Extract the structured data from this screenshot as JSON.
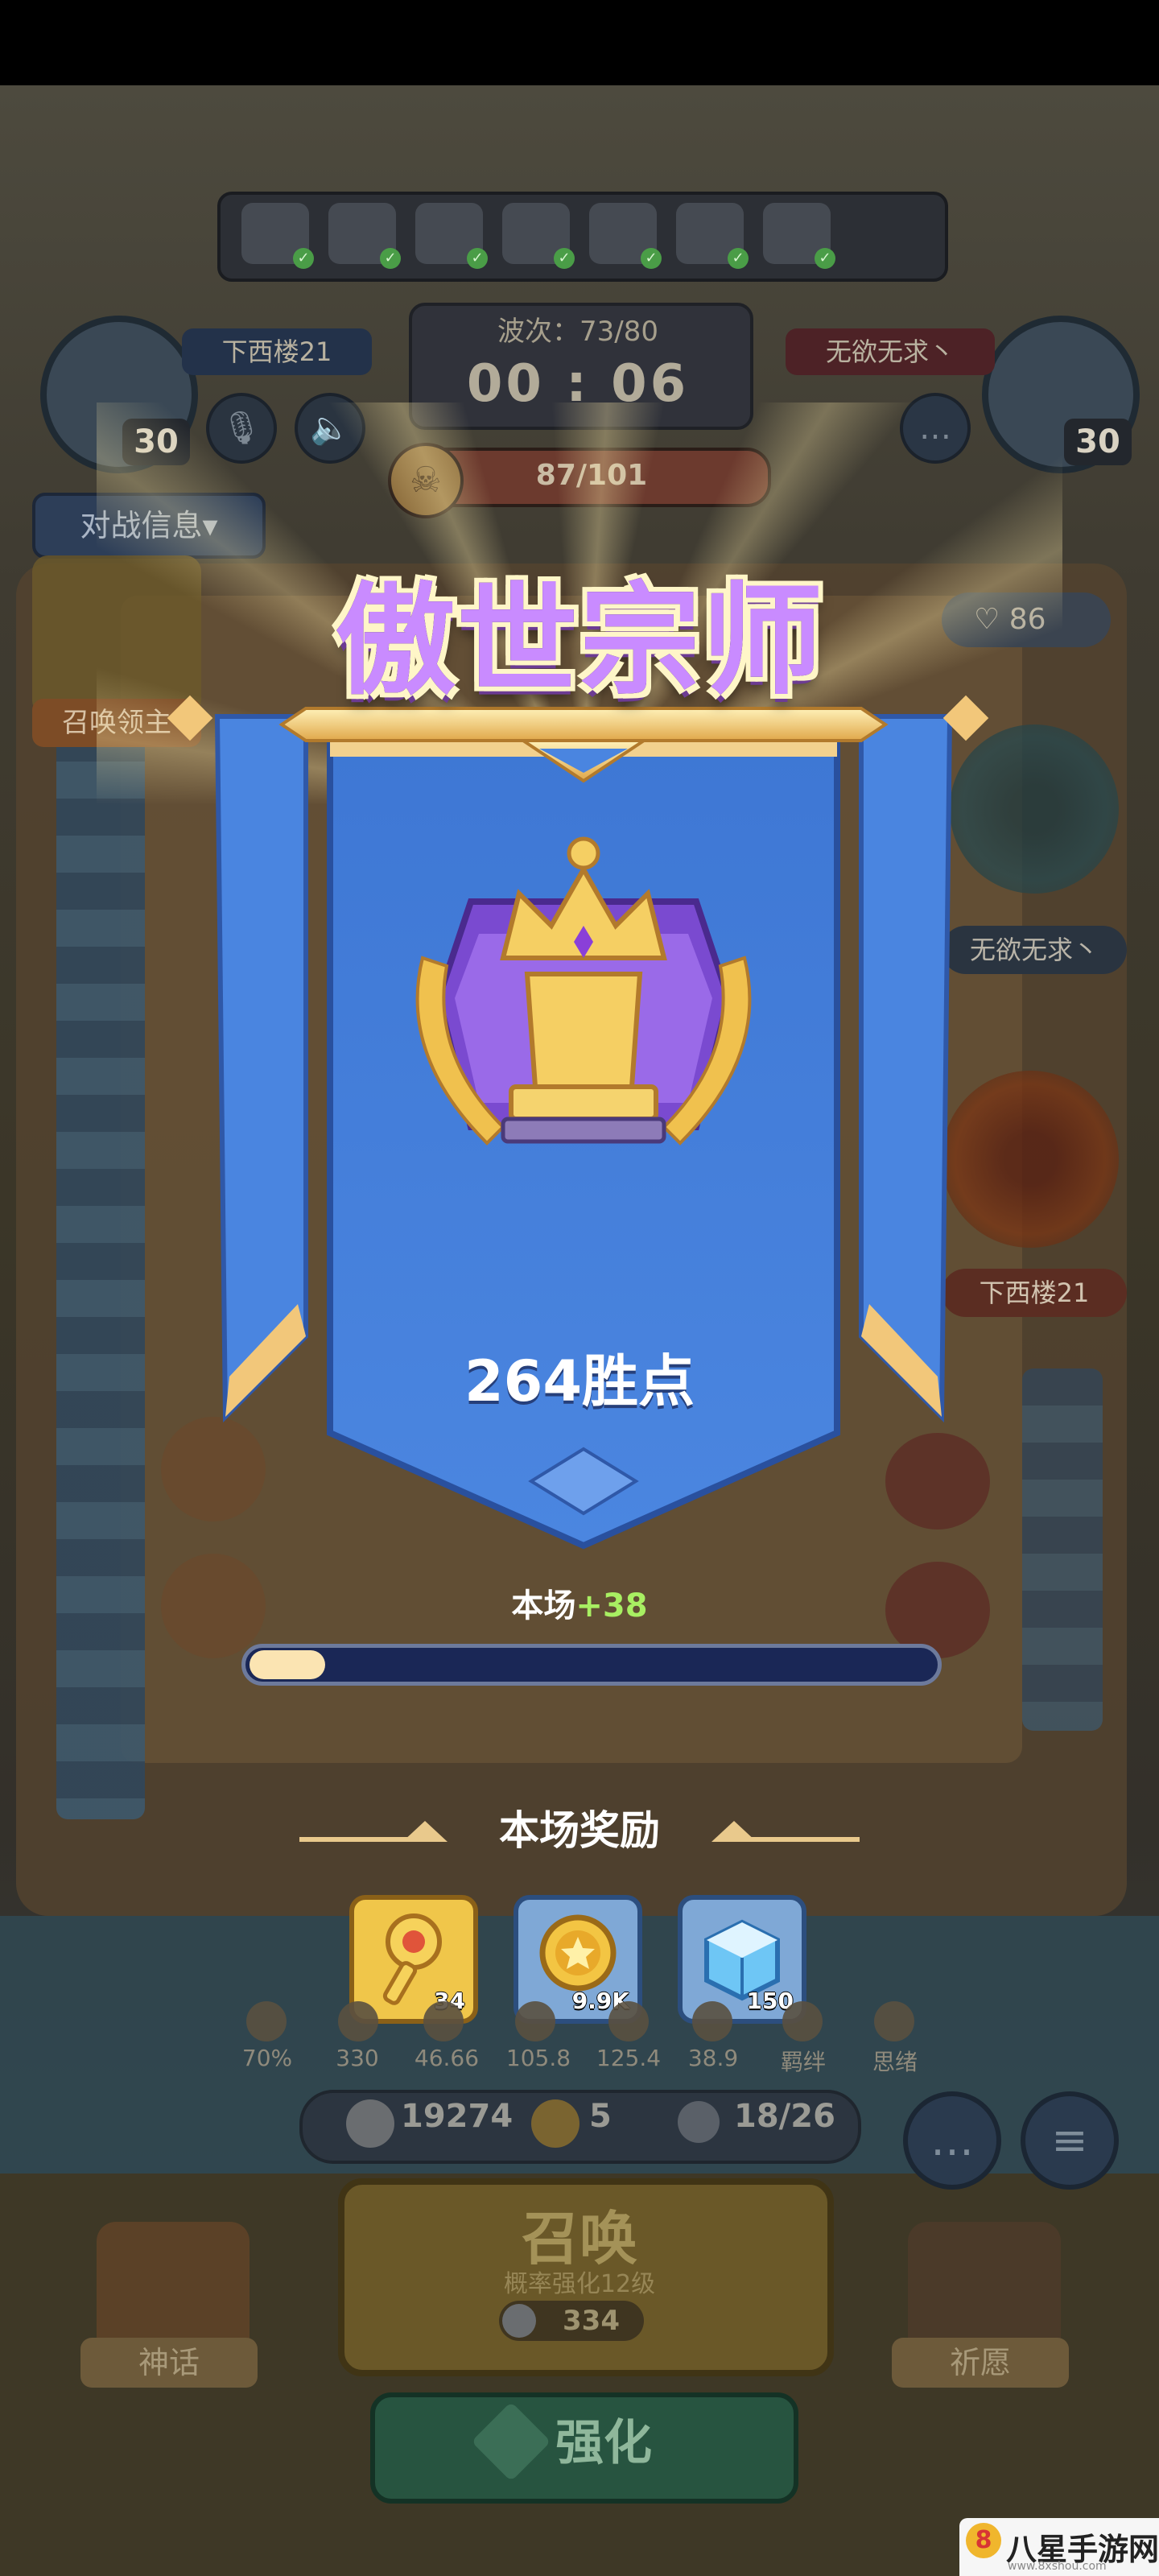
{
  "header": {
    "wave_label": "波次：73/80",
    "timer": "00 : 06",
    "boss_hp": "87/101",
    "battle_info": "对战信息▾",
    "left_player": {
      "name": "下西楼21",
      "level": "30"
    },
    "right_player": {
      "name": "无欲无求丶",
      "level": "30"
    },
    "hero_slots": [
      "✓",
      "✓",
      "✓",
      "✓",
      "✓",
      "✓",
      "✓"
    ]
  },
  "board": {
    "summon_lord": "召唤领主",
    "heart_count": "86",
    "side_name_top": "无欲无求丶",
    "side_name_bottom": "下西楼21"
  },
  "result": {
    "rank_title": "傲世宗师",
    "win_points": "264胜点",
    "session_prefix": "本场",
    "session_delta": "+38",
    "progress_fraction": 0.11
  },
  "rewards": {
    "title": "本场奖励",
    "items": [
      {
        "name": "key",
        "qty": "34",
        "color": "#f0c64a"
      },
      {
        "name": "coin",
        "qty": "9.9K",
        "color": "#7fa8d6"
      },
      {
        "name": "ice-cube",
        "qty": "150",
        "color": "#7fa8d6"
      }
    ]
  },
  "stats": {
    "values": [
      "70%",
      "330",
      "46.66",
      "105.8",
      "125.4",
      "38.9",
      "羁绊",
      "思绪"
    ]
  },
  "resources": {
    "silver": "19274",
    "clover": "5",
    "population": "18/26"
  },
  "actions": {
    "summon": "召唤",
    "summon_sub": "概率强化12级",
    "summon_cost": "334",
    "upgrade": "强化",
    "myth": "神话",
    "wish": "祈愿"
  },
  "watermark": {
    "text": "八星手游网",
    "url": "www.8xshou.com",
    "logo": "8"
  },
  "colors": {
    "accent_purple": "#c98bff",
    "banner_blue": "#4b86e0",
    "gold": "#e9c98c",
    "green_plus": "#a8ef62"
  }
}
